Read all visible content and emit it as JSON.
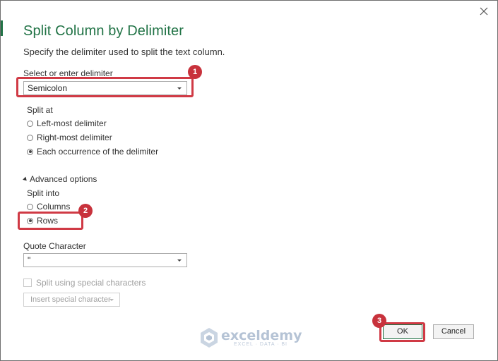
{
  "dialog": {
    "title": "Split Column by Delimiter",
    "subtitle": "Specify the delimiter used to split the text column.",
    "close_icon": "close-icon"
  },
  "delimiter": {
    "label": "Select or enter delimiter",
    "value": "Semicolon"
  },
  "split_at": {
    "label": "Split at",
    "options": [
      {
        "label": "Left-most delimiter",
        "checked": false
      },
      {
        "label": "Right-most delimiter",
        "checked": false
      },
      {
        "label": "Each occurrence of the delimiter",
        "checked": true
      }
    ]
  },
  "advanced": {
    "toggle_label": "Advanced options",
    "split_into_label": "Split into",
    "split_into_options": [
      {
        "label": "Columns",
        "checked": false
      },
      {
        "label": "Rows",
        "checked": true
      }
    ],
    "quote_label": "Quote Character",
    "quote_value": "\"",
    "special_chars_label": "Split using special characters",
    "insert_special_label": "Insert special character"
  },
  "buttons": {
    "ok": "OK",
    "cancel": "Cancel"
  },
  "annotations": {
    "step1": "1",
    "step2": "2",
    "step3": "3"
  },
  "watermark": {
    "name": "exceldemy",
    "tagline": "EXCEL · DATA · BI"
  },
  "colors": {
    "accent": "#217346",
    "highlight": "#d03a45"
  }
}
